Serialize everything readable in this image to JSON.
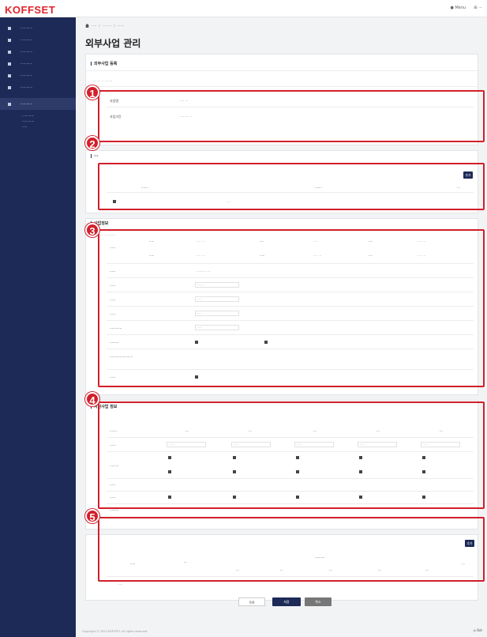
{
  "app": {
    "logo": "KOFFSET",
    "top_right": [
      "● Menu",
      "⊞ ⋯"
    ]
  },
  "sidebar": {
    "items": [
      {
        "label": "············"
      },
      {
        "label": "············"
      },
      {
        "label": "············"
      },
      {
        "label": "············"
      },
      {
        "label": "············"
      },
      {
        "label": "············"
      }
    ],
    "active": {
      "label": "············"
    },
    "sub_items": [
      "············",
      "············",
      "·····"
    ]
  },
  "breadcrumb": [
    "·····",
    "·········",
    "·······"
  ],
  "page_title": "외부사업 관리",
  "section1": {
    "title": "외부사업 등록",
    "note": "···· ··· ·· ········",
    "rows": [
      {
        "label": "사업명",
        "value": "····· ···"
      },
      {
        "label": "사업기간",
        "value": "········· ···"
      }
    ]
  },
  "section2": {
    "title": "···",
    "add_button": "추가",
    "headers": [
      "·······",
      "·······",
      "···"
    ],
    "row_value": "····"
  },
  "section3": {
    "title": "사업정보",
    "note": "······ ·· ········",
    "head_rows": [
      {
        "col0": "······",
        "a_label": "·····",
        "a_val": "···· ···",
        "b_label": "····",
        "b_val": "····",
        "c_label": "····",
        "c_val": "···· ···"
      },
      {
        "col0": "",
        "a_label": "·····",
        "a_val": "···· ···",
        "b_label": "·····",
        "b_val": "···· ···",
        "c_label": "····",
        "c_val": "···· ···"
      }
    ],
    "rows": [
      {
        "label": "······",
        "value": "·········· ···"
      },
      {
        "label": "······",
        "value": "·······"
      },
      {
        "label": "······",
        "value": "·····"
      },
      {
        "label": "······",
        "value": "·····"
      },
      {
        "label": "············",
        "value": "·····"
      },
      {
        "label": "·········",
        "value": ""
      },
      {
        "label": "·······················",
        "value": ""
      },
      {
        "label": "······",
        "value": ""
      }
    ]
  },
  "section4": {
    "title": "지원사업 정보",
    "col_headers": [
      "·······",
      "···",
      "···",
      "···",
      "···",
      "···"
    ],
    "rows": [
      {
        "label": "······"
      },
      {
        "label": "·········"
      },
      {
        "label": "······"
      },
      {
        "label": "······"
      },
      {
        "label": "·········"
      }
    ],
    "select_value": "······"
  },
  "section5": {
    "button": "추가",
    "header_top": "··········",
    "headers": [
      "·····",
      "···",
      "···",
      "···",
      "···",
      "···",
      "···",
      "···"
    ],
    "row_value": "·····"
  },
  "footer": {
    "buttons": [
      "목록",
      "저장",
      "취소"
    ],
    "copyright": "Copyright © 2023 KOFFSET. All rights reserved.",
    "chat": "◎ Bot"
  },
  "markers": [
    "1",
    "2",
    "3",
    "4",
    "5"
  ],
  "colors": {
    "sidebar": "#1d2a57",
    "accent": "#d1202b",
    "logo": "#e0232b"
  }
}
